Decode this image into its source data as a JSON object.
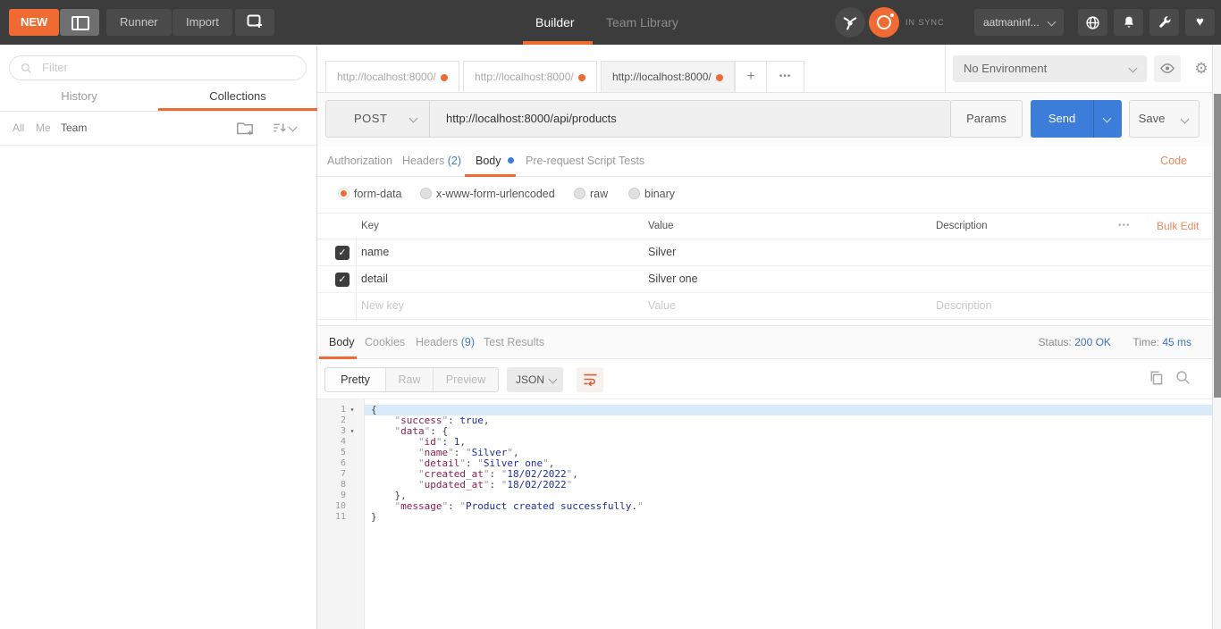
{
  "colors": {
    "accent": "#f06b34",
    "link": "#e98a5f",
    "blue": "#3b7dd8",
    "countblue": "#3d7ec2",
    "statusblue": "#3b73c4",
    "tok-p": "#444444",
    "tok-q": "#999999",
    "tok-k": "#8b2252",
    "tok-v": "#1e2f9e",
    "tok-s": "#1e2f9e"
  },
  "icons": {
    "heart": "♥",
    "gear": "⚙",
    "check": "✓",
    "plus": "+",
    "dots": "•••"
  },
  "header": {
    "new_label": "NEW",
    "runner_label": "Runner",
    "import_label": "Import",
    "tabs": [
      {
        "label": "Builder",
        "active": true
      },
      {
        "label": "Team Library",
        "active": false
      }
    ],
    "sync_status": "IN SYNC",
    "account": "aatmaninf..."
  },
  "sidebar": {
    "filter_placeholder": "Filter",
    "tabs": [
      {
        "label": "History",
        "active": false
      },
      {
        "label": "Collections",
        "active": true
      }
    ],
    "scopes": [
      "All",
      "Me",
      "Team"
    ]
  },
  "tabs_bar": {
    "request_tabs": [
      {
        "title": "http://localhost:8000/",
        "active": false
      },
      {
        "title": "http://localhost:8000/",
        "active": false
      },
      {
        "title": "http://localhost:8000/",
        "active": true
      }
    ],
    "add_label": "+",
    "more_label": "•••",
    "environment": "No Environment"
  },
  "request": {
    "method": "POST",
    "url": "http://localhost:8000/api/products",
    "params_label": "Params",
    "send_label": "Send",
    "save_label": "Save",
    "editor_tabs": [
      {
        "label": "Authorization"
      },
      {
        "label": "Headers",
        "count": "(2)"
      },
      {
        "label": "Body",
        "active": true
      },
      {
        "label": "Pre-request Script"
      },
      {
        "label": "Tests"
      }
    ],
    "code_link": "Code",
    "body_types": [
      {
        "label": "form-data",
        "selected": true
      },
      {
        "label": "x-www-form-urlencoded",
        "selected": false
      },
      {
        "label": "raw",
        "selected": false
      },
      {
        "label": "binary",
        "selected": false
      }
    ],
    "table": {
      "headers": [
        "Key",
        "Value",
        "Description"
      ],
      "bulk_edit": "Bulk Edit",
      "rows": [
        {
          "key": "name",
          "value": "Silver",
          "checked": true
        },
        {
          "key": "detail",
          "value": "Silver one",
          "checked": true
        }
      ],
      "placeholder_row": {
        "key": "New key",
        "value": "Value",
        "description": "Description"
      }
    }
  },
  "response": {
    "tabs": [
      {
        "label": "Body",
        "active": true
      },
      {
        "label": "Cookies"
      },
      {
        "label": "Headers",
        "count": "(9)"
      },
      {
        "label": "Test Results"
      }
    ],
    "status_label": "Status:",
    "status_value": "200 OK",
    "time_label": "Time:",
    "time_value": "45 ms",
    "view_modes": [
      {
        "label": "Pretty",
        "active": true
      },
      {
        "label": "Raw",
        "active": false
      },
      {
        "label": "Preview",
        "active": false
      }
    ],
    "format": "JSON",
    "code": {
      "lines": [
        {
          "num": "1",
          "fold": true,
          "highlight": true,
          "segs": [
            [
              "p",
              "{"
            ]
          ]
        },
        {
          "num": "2",
          "segs": [
            [
              "p",
              "    "
            ],
            [
              "q",
              "\""
            ],
            [
              "k",
              "success"
            ],
            [
              "q",
              "\""
            ],
            [
              "p",
              ": "
            ],
            [
              "v",
              "true"
            ],
            [
              "p",
              ","
            ]
          ]
        },
        {
          "num": "3",
          "fold": true,
          "segs": [
            [
              "p",
              "    "
            ],
            [
              "q",
              "\""
            ],
            [
              "k",
              "data"
            ],
            [
              "q",
              "\""
            ],
            [
              "p",
              ": {"
            ]
          ]
        },
        {
          "num": "4",
          "segs": [
            [
              "p",
              "        "
            ],
            [
              "q",
              "\""
            ],
            [
              "k",
              "id"
            ],
            [
              "q",
              "\""
            ],
            [
              "p",
              ": "
            ],
            [
              "v",
              "1"
            ],
            [
              "p",
              ","
            ]
          ]
        },
        {
          "num": "5",
          "segs": [
            [
              "p",
              "        "
            ],
            [
              "q",
              "\""
            ],
            [
              "k",
              "name"
            ],
            [
              "q",
              "\""
            ],
            [
              "p",
              ": "
            ],
            [
              "q",
              "\""
            ],
            [
              "s",
              "Silver"
            ],
            [
              "q",
              "\""
            ],
            [
              "p",
              ","
            ]
          ]
        },
        {
          "num": "6",
          "segs": [
            [
              "p",
              "        "
            ],
            [
              "q",
              "\""
            ],
            [
              "k",
              "detail"
            ],
            [
              "q",
              "\""
            ],
            [
              "p",
              ": "
            ],
            [
              "q",
              "\""
            ],
            [
              "s",
              "Silver one"
            ],
            [
              "q",
              "\""
            ],
            [
              "p",
              ","
            ]
          ]
        },
        {
          "num": "7",
          "segs": [
            [
              "p",
              "        "
            ],
            [
              "q",
              "\""
            ],
            [
              "k",
              "created_at"
            ],
            [
              "q",
              "\""
            ],
            [
              "p",
              ": "
            ],
            [
              "q",
              "\""
            ],
            [
              "s",
              "18/02/2022"
            ],
            [
              "q",
              "\""
            ],
            [
              "p",
              ","
            ]
          ]
        },
        {
          "num": "8",
          "segs": [
            [
              "p",
              "        "
            ],
            [
              "q",
              "\""
            ],
            [
              "k",
              "updated_at"
            ],
            [
              "q",
              "\""
            ],
            [
              "p",
              ": "
            ],
            [
              "q",
              "\""
            ],
            [
              "s",
              "18/02/2022"
            ],
            [
              "q",
              "\""
            ]
          ]
        },
        {
          "num": "9",
          "segs": [
            [
              "p",
              "    },"
            ]
          ]
        },
        {
          "num": "10",
          "segs": [
            [
              "p",
              "    "
            ],
            [
              "q",
              "\""
            ],
            [
              "k",
              "message"
            ],
            [
              "q",
              "\""
            ],
            [
              "p",
              ": "
            ],
            [
              "q",
              "\""
            ],
            [
              "s",
              "Product created successfully."
            ],
            [
              "q",
              "\""
            ]
          ]
        },
        {
          "num": "11",
          "segs": [
            [
              "p",
              "}"
            ]
          ]
        }
      ]
    }
  }
}
